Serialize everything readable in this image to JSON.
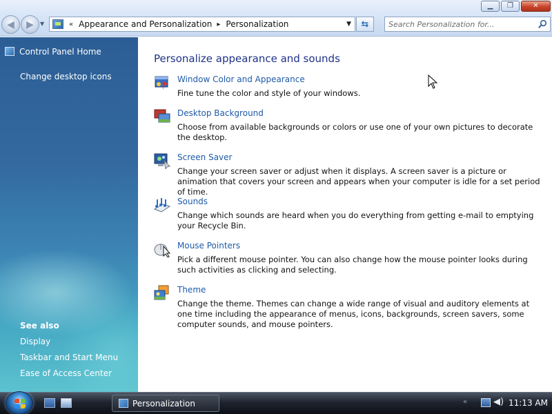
{
  "window": {
    "controls": {
      "minimize": "▁",
      "maximize": "❐",
      "close": "✕"
    }
  },
  "navigation": {
    "back_icon": "back-arrow-icon",
    "forward_icon": "forward-arrow-icon",
    "back_glyph": "◀",
    "forward_glyph": "▶"
  },
  "address": {
    "overflow": "«",
    "breadcrumbs": [
      "Appearance and Personalization",
      "Personalization"
    ],
    "separator": "▸",
    "dropdown": "▼",
    "refresh": "⇆"
  },
  "search": {
    "placeholder": "Search Personalization for..."
  },
  "sidebar": {
    "home_link": "Control Panel Home",
    "tasks": [
      "Change desktop icons"
    ],
    "see_also_header": "See also",
    "see_also": [
      "Display",
      "Taskbar and Start Menu",
      "Ease of Access Center"
    ]
  },
  "main": {
    "title": "Personalize appearance and sounds",
    "items": [
      {
        "icon": "window-color-icon",
        "label": "Window Color and Appearance",
        "description": "Fine tune the color and style of your windows."
      },
      {
        "icon": "desktop-background-icon",
        "label": "Desktop Background",
        "description": "Choose from available backgrounds or colors or use one of your own pictures to decorate the desktop."
      },
      {
        "icon": "screen-saver-icon",
        "label": "Screen Saver",
        "description": "Change your screen saver or adjust when it displays. A screen saver is a picture or animation that covers your screen and appears when your computer is idle for a set period of time."
      },
      {
        "icon": "sounds-icon",
        "label": "Sounds",
        "description": "Change which sounds are heard when you do everything from getting e-mail to emptying your Recycle Bin."
      },
      {
        "icon": "mouse-pointers-icon",
        "label": "Mouse Pointers",
        "description": "Pick a different mouse pointer. You can also change how the mouse pointer looks during such activities as clicking and selecting."
      },
      {
        "icon": "theme-icon",
        "label": "Theme",
        "description": "Change the theme. Themes can change a wide range of visual and auditory elements at one time including the appearance of menus, icons, backgrounds, screen savers, some computer sounds, and mouse pointers."
      }
    ]
  },
  "taskbar": {
    "active_window": "Personalization",
    "tray_chevron": "«",
    "volume_glyph": "◀)",
    "clock": "11:13 AM"
  },
  "colors": {
    "link": "#1e5aa8",
    "title": "#1e3287",
    "sidebar_top": "#2c5e95",
    "sidebar_bottom": "#5cc2cf"
  }
}
